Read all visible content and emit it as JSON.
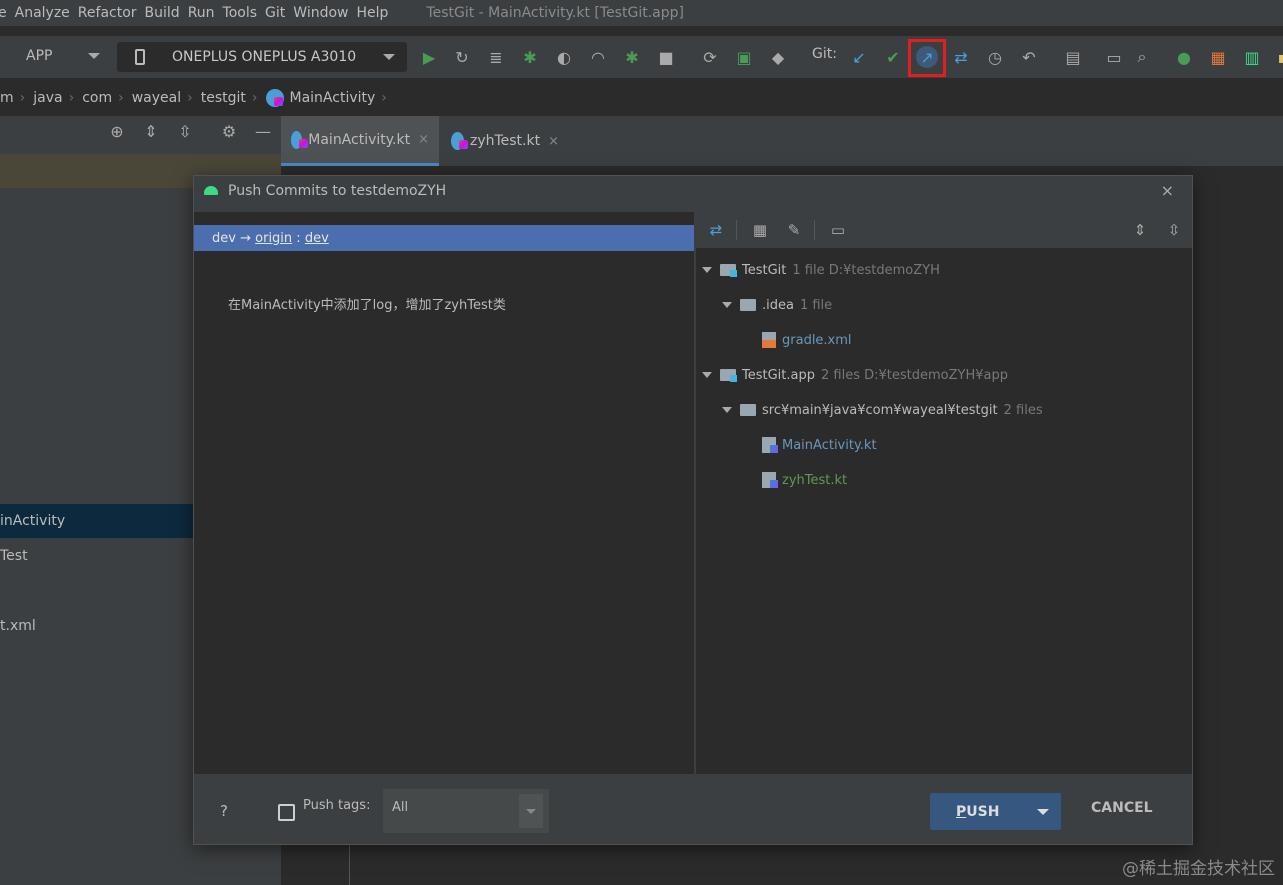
{
  "menu": {
    "items": [
      "e",
      "Analyze",
      "Refactor",
      "Build",
      "Run",
      "Tools",
      "Git",
      "Window",
      "Help"
    ],
    "window_title": "TestGit - MainActivity.kt [TestGit.app]"
  },
  "toolbar": {
    "app_config": "APP",
    "device": "ONEPLUS ONEPLUS A3010",
    "git_label": "Git:"
  },
  "breadcrumb": {
    "items": [
      "m",
      "java",
      "com",
      "wayeal",
      "testgit",
      "MainActivity"
    ]
  },
  "left_panel": {
    "items": [
      "inActivity",
      "Test",
      "t.xml"
    ]
  },
  "editor": {
    "tabs": [
      {
        "label": "MainActivity.kt",
        "close": "×"
      },
      {
        "label": "zyhTest.kt",
        "close": "×"
      }
    ]
  },
  "dialog": {
    "title": "Push Commits to testdemoZYH",
    "close": "×",
    "branch": {
      "local": "dev",
      "arrow": "→",
      "remote": "origin",
      "colon": " : ",
      "remote_branch": "dev"
    },
    "commit_message": "在MainActivity中添加了log，增加了zyhTest类",
    "tree": [
      {
        "name": "TestGit",
        "meta": "1 file  D:¥testdemoZYH"
      },
      {
        "name": ".idea",
        "meta": "1 file"
      },
      {
        "name": "gradle.xml",
        "meta": ""
      },
      {
        "name": "TestGit.app",
        "meta": "2 files  D:¥testdemoZYH¥app"
      },
      {
        "name": "src¥main¥java¥com¥wayeal¥testgit",
        "meta": "2 files"
      },
      {
        "name": "MainActivity.kt",
        "meta": ""
      },
      {
        "name": "zyhTest.kt",
        "meta": ""
      }
    ],
    "footer": {
      "help": "?",
      "push_tags_label": "Push tags:",
      "push_tags_value": "All",
      "push_first": "P",
      "push_rest": "USH",
      "cancel": "CANCEL"
    }
  },
  "watermark": "@稀土掘金技术社区",
  "colors": {
    "selection": "#4b6eaf",
    "push_button": "#365880",
    "highlight_box": "#e0201c",
    "modified_file": "#6897bb",
    "new_file": "#629755"
  }
}
